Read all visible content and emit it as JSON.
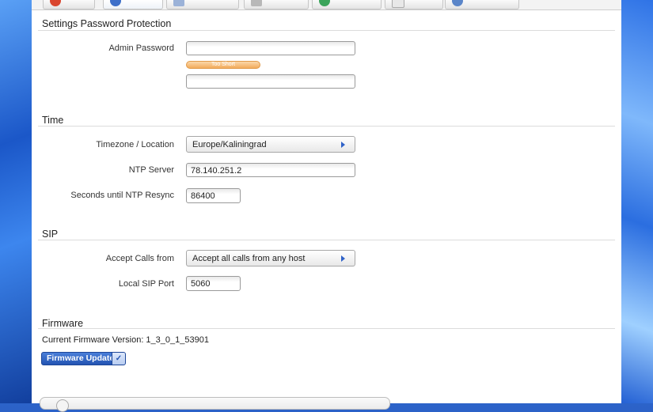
{
  "colors": {
    "accent": "#2354b2",
    "strength_weak": "#f3ac5c"
  },
  "password_section": {
    "title": "Settings Password Protection",
    "admin_label": "Admin Password",
    "admin_value": "",
    "strength": "Too Short",
    "confirm_value": ""
  },
  "time_section": {
    "title": "Time",
    "timezone_label": "Timezone / Location",
    "timezone_value": "Europe/Kaliningrad",
    "ntp_label": "NTP Server",
    "ntp_value": "78.140.251.2",
    "resync_label": "Seconds until NTP Resync",
    "resync_value": "86400"
  },
  "sip_section": {
    "title": "SIP",
    "accept_label": "Accept Calls from",
    "accept_value": "Accept all calls from any host",
    "port_label": "Local SIP Port",
    "port_value": "5060"
  },
  "firmware_section": {
    "title": "Firmware",
    "version_text": "Current Firmware Version: 1_3_0_1_53901",
    "update_label": "Firmware Update"
  },
  "icons": [
    "settings-tab-icon",
    "globe-tab-icon",
    "logging-tab-icon",
    "checkmark-icon",
    "select-arrow-icon"
  ]
}
